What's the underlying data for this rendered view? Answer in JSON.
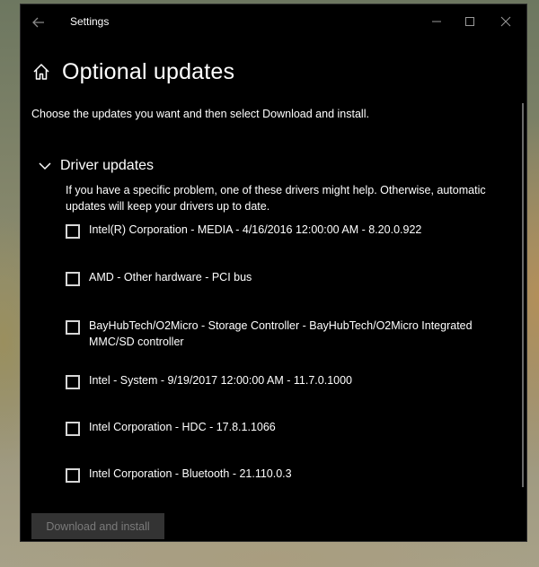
{
  "window": {
    "title": "Settings",
    "back_icon": "back-arrow-icon",
    "controls": [
      "minimize-icon",
      "maximize-icon",
      "close-icon"
    ]
  },
  "page": {
    "home_icon": "home-icon",
    "title": "Optional updates",
    "intro": "Choose the updates you want and then select Download and install."
  },
  "section": {
    "chevron_icon": "chevron-down-icon",
    "title": "Driver updates",
    "description": "If you have a specific problem, one of these drivers might help. Otherwise, automatic updates will keep your drivers up to date."
  },
  "drivers": [
    {
      "label": "Intel(R) Corporation - MEDIA - 4/16/2016 12:00:00 AM - 8.20.0.922",
      "checked": false
    },
    {
      "label": "AMD - Other hardware - PCI bus",
      "checked": false
    },
    {
      "label": "BayHubTech/O2Micro - Storage Controller - BayHubTech/O2Micro Integrated MMC/SD controller",
      "checked": false
    },
    {
      "label": "Intel - System - 9/19/2017 12:00:00 AM - 11.7.0.1000",
      "checked": false
    },
    {
      "label": "Intel Corporation - HDC - 17.8.1.1066",
      "checked": false
    },
    {
      "label": "Intel Corporation - Bluetooth - 21.110.0.3",
      "checked": false
    }
  ],
  "actions": {
    "download_label": "Download and install",
    "download_enabled": false
  },
  "colors": {
    "window_bg": "#000000",
    "text": "#ffffff",
    "disabled_button_bg": "#333333",
    "disabled_button_text": "#7a7a7a"
  }
}
